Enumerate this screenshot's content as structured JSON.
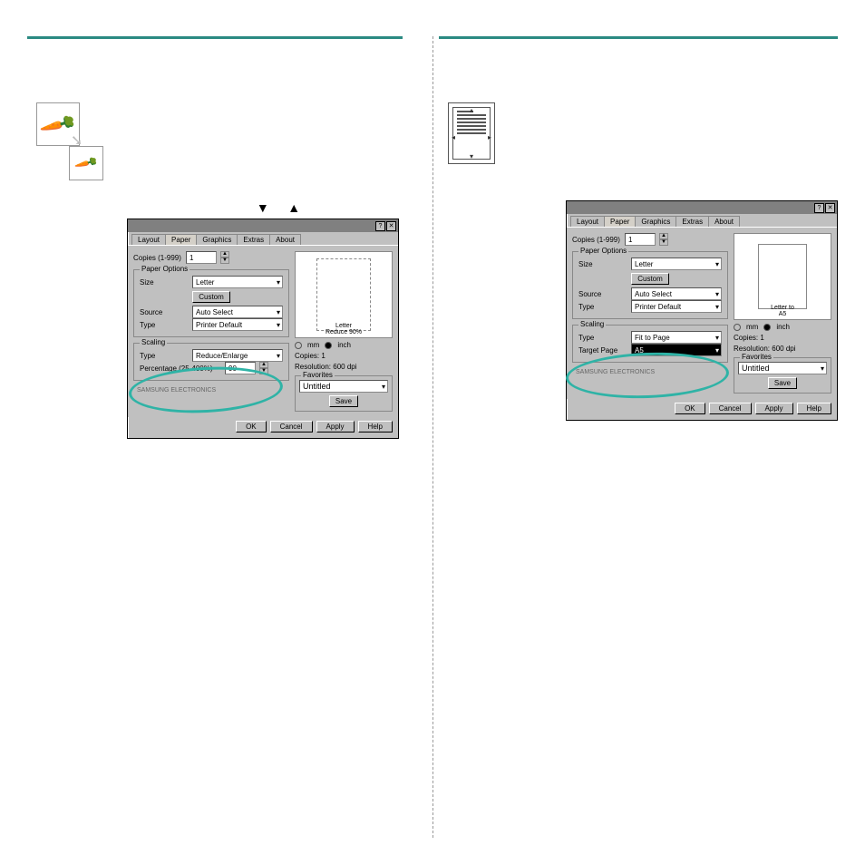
{
  "left": {
    "dialog": {
      "tabs": {
        "layout": "Layout",
        "paper": "Paper",
        "graphics": "Graphics",
        "extras": "Extras",
        "about": "About"
      },
      "copies_label": "Copies (1-999)",
      "copies_value": "1",
      "paper_options": "Paper Options",
      "size_label": "Size",
      "size_value": "Letter",
      "custom": "Custom",
      "source_label": "Source",
      "source_value": "Auto Select",
      "type_label": "Type",
      "type_value": "Printer Default",
      "scaling": "Scaling",
      "scale_type_label": "Type",
      "scale_type_value": "Reduce/Enlarge",
      "percent_label": "Percentage (25-400%)",
      "percent_value": "90",
      "preview_label": "Letter\nReduce 90%",
      "unit_mm": "mm",
      "unit_inch": "inch",
      "info_copies": "Copies: 1",
      "info_res": "Resolution: 600 dpi",
      "fav": "Favorites",
      "fav_value": "Untitled",
      "save": "Save",
      "logo": "SAMSUNG ELECTRONICS",
      "ok": "OK",
      "cancel": "Cancel",
      "apply": "Apply",
      "help": "Help"
    }
  },
  "right": {
    "dialog": {
      "tabs": {
        "layout": "Layout",
        "paper": "Paper",
        "graphics": "Graphics",
        "extras": "Extras",
        "about": "About"
      },
      "copies_label": "Copies (1-999)",
      "copies_value": "1",
      "paper_options": "Paper Options",
      "size_label": "Size",
      "size_value": "Letter",
      "custom": "Custom",
      "source_label": "Source",
      "source_value": "Auto Select",
      "type_label": "Type",
      "type_value": "Printer Default",
      "scaling": "Scaling",
      "scale_type_label": "Type",
      "scale_type_value": "Fit to Page",
      "target_label": "Target Page",
      "target_value": "A5",
      "preview_label": "Letter to\nA5",
      "unit_mm": "mm",
      "unit_inch": "inch",
      "info_copies": "Copies: 1",
      "info_res": "Resolution: 600 dpi",
      "fav": "Favorites",
      "fav_value": "Untitled",
      "save": "Save",
      "logo": "SAMSUNG ELECTRONICS",
      "ok": "OK",
      "cancel": "Cancel",
      "apply": "Apply",
      "help": "Help"
    }
  },
  "triangles": {
    "down": "▼",
    "up": "▲"
  }
}
